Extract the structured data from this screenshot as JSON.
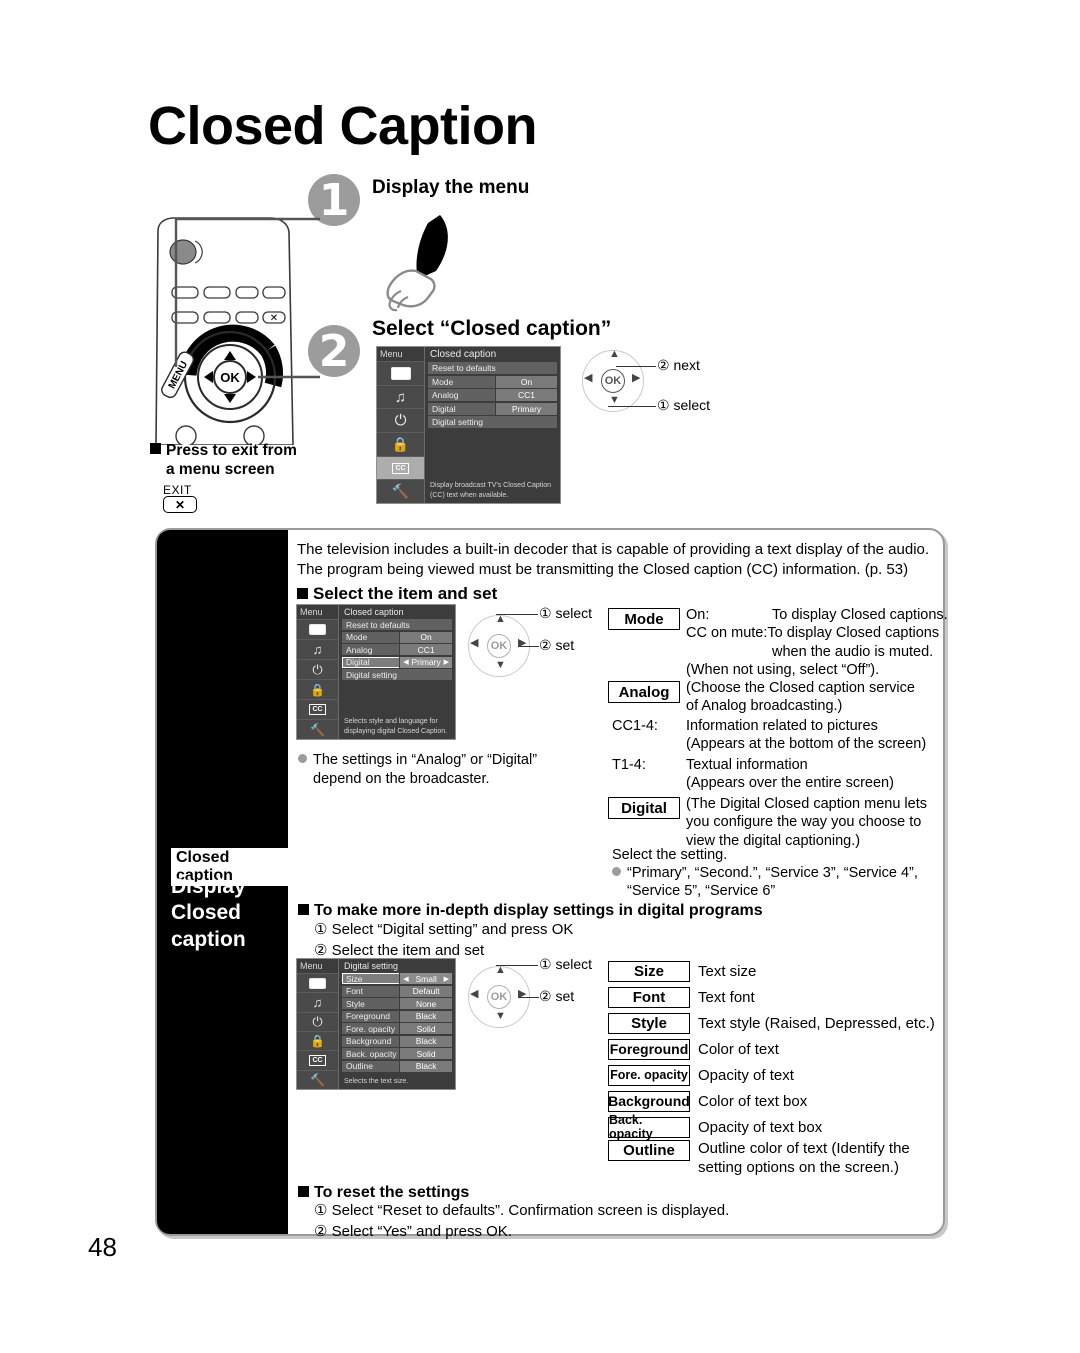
{
  "page": {
    "title": "Closed Caption",
    "number": "48"
  },
  "steps": [
    {
      "num": "1",
      "label": "Display the menu"
    },
    {
      "num": "2",
      "label": "Select “Closed caption”"
    }
  ],
  "remote": {
    "menu_button_label": "MENU",
    "ok_label": "OK",
    "exit_key_glyph": "✕"
  },
  "exit_note": {
    "line1": "Press to exit from",
    "line2": "a menu screen",
    "key_label": "EXIT",
    "key_glyph": "✕"
  },
  "menu_step2": {
    "rail_title": "Menu",
    "header": "Closed caption",
    "rows": [
      {
        "label": "Reset to defaults",
        "value": ""
      },
      {
        "label": "Mode",
        "value": "On"
      },
      {
        "label": "Analog",
        "value": "CC1"
      },
      {
        "label": "Digital",
        "value": "Primary"
      },
      {
        "label": "Digital setting",
        "value": ""
      }
    ],
    "note": "Display broadcast TV's Closed Caption (CC) text when available.",
    "icons": [
      "picture-icon",
      "audio-icon",
      "timer-icon",
      "lock-icon",
      "cc-icon",
      "setup-icon"
    ]
  },
  "wheel_step2": {
    "ok": "OK",
    "callout_top": "② next",
    "callout_bottom": "① select"
  },
  "card": {
    "tab_chip": "Closed caption",
    "tab_text_line1": "Display",
    "tab_text_line2": "Closed",
    "tab_text_line3": "caption",
    "intro_line1": "The television includes a built-in decoder that is capable of providing a text display of the audio.",
    "intro_line2": "The program being viewed must be transmitting the Closed caption (CC) information. (p. 53)",
    "heading_select_item": "Select the item and set",
    "broadcaster_note_line1": "The settings in “Analog” or “Digital”",
    "broadcaster_note_line2": "depend on the broadcaster.",
    "heading_indepth": "To make more in-depth display settings in digital programs",
    "indepth_step1": "① Select “Digital setting” and press OK",
    "indepth_step2": "② Select the item and set",
    "heading_reset": "To reset the settings",
    "reset_step1": "① Select “Reset to defaults”. Confirmation screen is displayed.",
    "reset_step2": "② Select “Yes” and press OK."
  },
  "menu_mid": {
    "rail_title": "Menu",
    "header": "Closed caption",
    "rows": [
      {
        "label": "Reset to defaults",
        "value": ""
      },
      {
        "label": "Mode",
        "value": "On"
      },
      {
        "label": "Analog",
        "value": "CC1"
      },
      {
        "label": "Digital",
        "value": "Primary",
        "highlight": true
      },
      {
        "label": "Digital setting",
        "value": ""
      }
    ],
    "note": "Selects style and language for displaying digital Closed Caption."
  },
  "menu_digital": {
    "rail_title": "Menu",
    "header": "Digital setting",
    "rows": [
      {
        "label": "Size",
        "value": "Small",
        "highlight": true
      },
      {
        "label": "Font",
        "value": "Default"
      },
      {
        "label": "Style",
        "value": "None"
      },
      {
        "label": "Foreground",
        "value": "Black"
      },
      {
        "label": "Fore. opacity",
        "value": "Solid"
      },
      {
        "label": "Background",
        "value": "Black"
      },
      {
        "label": "Back. opacity",
        "value": "Solid"
      },
      {
        "label": "Outline",
        "value": "Black"
      }
    ],
    "note": "Selects the text size."
  },
  "wheel_mid": {
    "ok": "OK",
    "callout_top": "① select",
    "callout_bottom": "② set"
  },
  "wheel_digital": {
    "ok": "OK",
    "callout_top": "① select",
    "callout_bottom": "② set"
  },
  "definitions_cc": {
    "mode": {
      "key": "Mode",
      "line1_term": "On:",
      "line1_desc": "To display Closed captions.",
      "line2_term": "CC on mute:",
      "line2_desc": "To display Closed captions",
      "line3_desc": "when the audio is muted.",
      "line4": "(When not using, select “Off”)."
    },
    "analog": {
      "key": "Analog",
      "desc_line1": "(Choose the Closed caption service",
      "desc_line2": "of Analog broadcasting.)",
      "cc_term": "CC1-4:",
      "cc_desc1": "Information related to pictures",
      "cc_desc2": "(Appears at the bottom of the screen)",
      "t_term": "T1-4:",
      "t_desc1": "Textual information",
      "t_desc2": "(Appears over the entire screen)"
    },
    "digital": {
      "key": "Digital",
      "desc_line1": "(The Digital Closed caption menu lets",
      "desc_line2": "you configure the way you choose to",
      "desc_line3": "view the digital captioning.)",
      "select_setting": "Select the setting.",
      "options_line1": "“Primary”, “Second.”, “Service 3”, “Service 4”,",
      "options_line2": "“Service 5”, “Service 6”"
    }
  },
  "definitions_digital": [
    {
      "key": "Size",
      "desc": "Text size"
    },
    {
      "key": "Font",
      "desc": "Text font"
    },
    {
      "key": "Style",
      "desc": "Text style (Raised, Depressed, etc.)"
    },
    {
      "key": "Foreground",
      "desc": "Color of text"
    },
    {
      "key": "Fore. opacity",
      "desc": "Opacity of text"
    },
    {
      "key": "Background",
      "desc": "Color of text box"
    },
    {
      "key": "Back. opacity",
      "desc": "Opacity of text box"
    },
    {
      "key": "Outline",
      "desc": "Outline color of text (Identify the"
    },
    {
      "key": "",
      "desc": "setting options on the screen.)"
    }
  ]
}
